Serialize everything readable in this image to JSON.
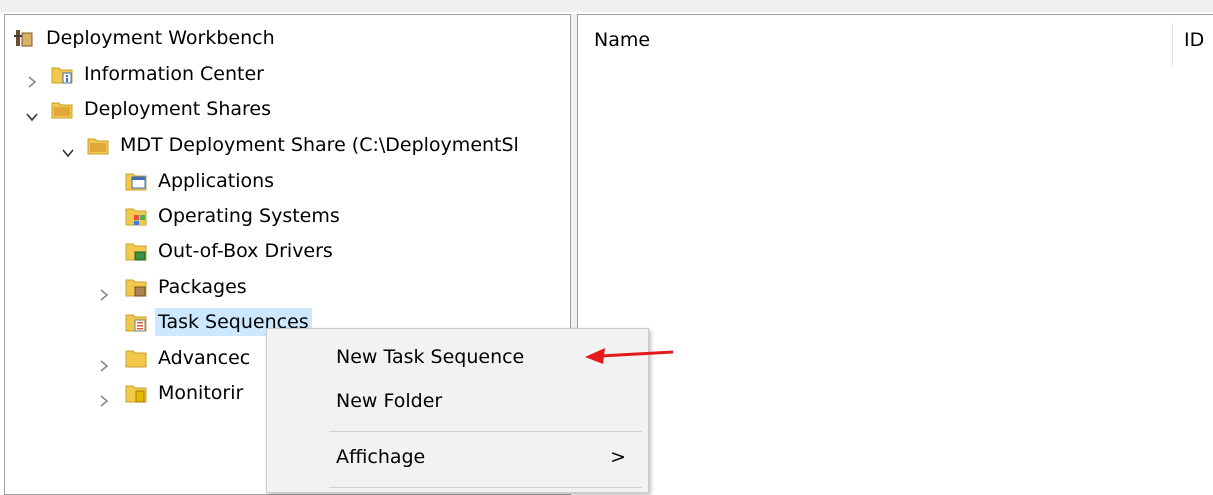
{
  "tree": {
    "root": "Deployment Workbench",
    "items": [
      {
        "label": "Information Center"
      },
      {
        "label": "Deployment Shares"
      },
      {
        "label": "MDT Deployment Share (C:\\DeploymentSl"
      },
      {
        "label": "Applications"
      },
      {
        "label": "Operating Systems"
      },
      {
        "label": "Out-of-Box Drivers"
      },
      {
        "label": "Packages"
      },
      {
        "label": "Task Sequences"
      },
      {
        "label": "Advancec"
      },
      {
        "label": "Monitorir"
      }
    ]
  },
  "list": {
    "columns": [
      "Name",
      "ID"
    ]
  },
  "context_menu": {
    "items": [
      {
        "label": "New Task Sequence"
      },
      {
        "label": "New Folder"
      },
      {
        "label": "Affichage",
        "submenu": ">"
      }
    ]
  },
  "annotation": {
    "color": "#e41b1b"
  }
}
